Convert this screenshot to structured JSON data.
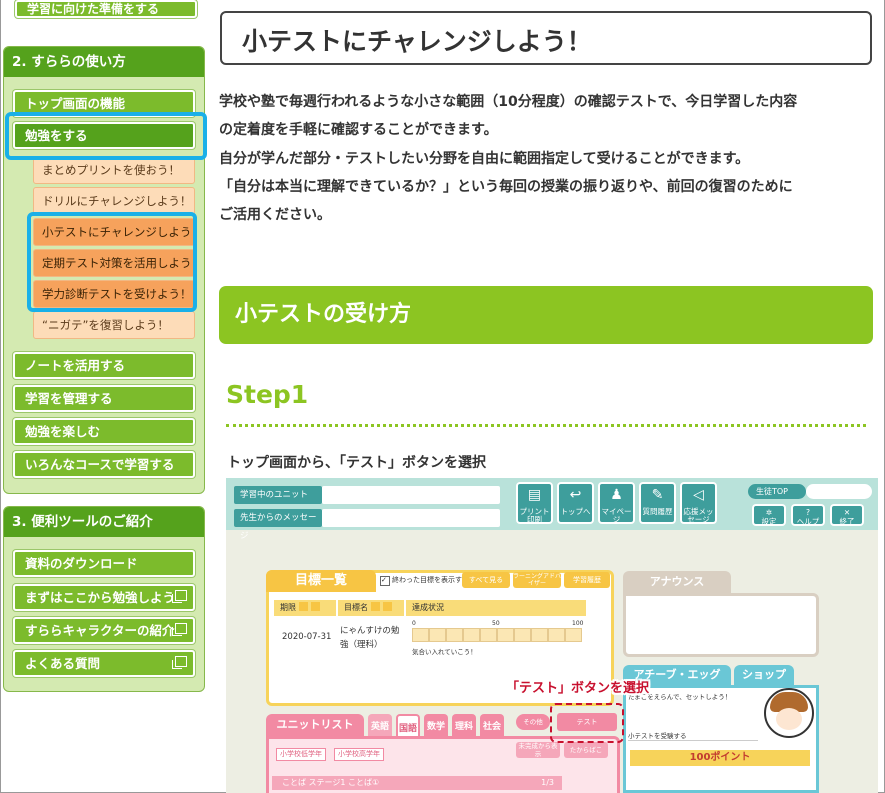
{
  "sidebar": {
    "top_button": "学習に向けた準備をする",
    "section2": {
      "title": "2. すららの使い方",
      "items": [
        {
          "label": "トップ画面の機能"
        },
        {
          "label": "勉強をする"
        }
      ],
      "sub_items": [
        {
          "label": "まとめプリントを使おう！"
        },
        {
          "label": "ドリルにチャレンジしよう！"
        },
        {
          "label": "小テストにチャレンジしよう！"
        },
        {
          "label": "定期テスト対策を活用しよう！"
        },
        {
          "label": "学力診断テストを受けよう！"
        },
        {
          "label": "“ニガテ”を復習しよう！"
        }
      ],
      "more_items": [
        {
          "label": "ノートを活用する"
        },
        {
          "label": "学習を管理する"
        },
        {
          "label": "勉強を楽しむ"
        },
        {
          "label": "いろんなコースで学習する"
        }
      ]
    },
    "section3": {
      "title": "3. 便利ツールのご紹介",
      "items": [
        {
          "label": "資料のダウンロード"
        },
        {
          "label": "まずはここから勉強しよう"
        },
        {
          "label": "すららキャラクターの紹介"
        },
        {
          "label": "よくある質問"
        }
      ]
    }
  },
  "main": {
    "title": "小テストにチャレンジしよう！",
    "paragraph": [
      "学校や塾で毎週行われるような小さな範囲（10分程度）の確認テストで、今日学習した内容",
      "の定着度を手軽に確認することができます。",
      "自分が学んだ部分・テストしたい分野を自由に範囲指定して受けることができます。",
      "「自分は本当に理解できているか？」という毎回の授業の振り返りや、前回の復習のために",
      "ご活用ください。"
    ],
    "section_heading": "小テストの受け方",
    "step_title": "Step1",
    "step_instruction": "トップ画面から、「テスト」ボタンを選択"
  },
  "screenshot": {
    "unit_label": "学習中のユニット",
    "message_label": "先生からのメッセージ",
    "toolbar": [
      {
        "label": "プリント印刷",
        "icon": "printer-icon"
      },
      {
        "label": "トップへ",
        "icon": "return-icon"
      },
      {
        "label": "マイページ",
        "icon": "person-icon"
      },
      {
        "label": "質問履歴",
        "icon": "chat-icon"
      },
      {
        "label": "応援メッセージ",
        "icon": "megaphone-icon"
      }
    ],
    "student_top": "生徒TOP",
    "settings": "設定",
    "help": "ヘルプ",
    "exit": "終了",
    "goals_title": "目標一覧",
    "goals_check": "終わった目標を表示する",
    "goals_buttons": [
      "すべて見る",
      "ラーニングアドバイザー",
      "学習履歴"
    ],
    "goals_headers": [
      "期限",
      "目標名",
      "達成状況"
    ],
    "goals_row": {
      "date": "2020-07-31",
      "name": "にゃんすけの勉強（理科）",
      "note": "気合い入れていこう！"
    },
    "progress_ticks": [
      "0",
      "50",
      "100"
    ],
    "announce": "アナウンス",
    "achieve_tab": "アチーブ・エッグ",
    "shop_tab": "ショップ",
    "achieve_msg": "たまごをえらんで、セットしよう！",
    "achieve_line": "小テストを受験する",
    "points": "100ポイント",
    "unit_list": "ユニットリスト",
    "subject_tabs": [
      "英語",
      "国語",
      "数学",
      "理科",
      "社会"
    ],
    "other_btn": "その他",
    "test_btn": "テスト",
    "grades": [
      "小学校低学年",
      "小学校高学年"
    ],
    "small_btns": [
      "未完成から表示",
      "たからばこ"
    ],
    "unit_row": "ことば ステージ1 ことば①",
    "unit_page": "1/3",
    "callout": "「テスト」ボタンを選択"
  }
}
